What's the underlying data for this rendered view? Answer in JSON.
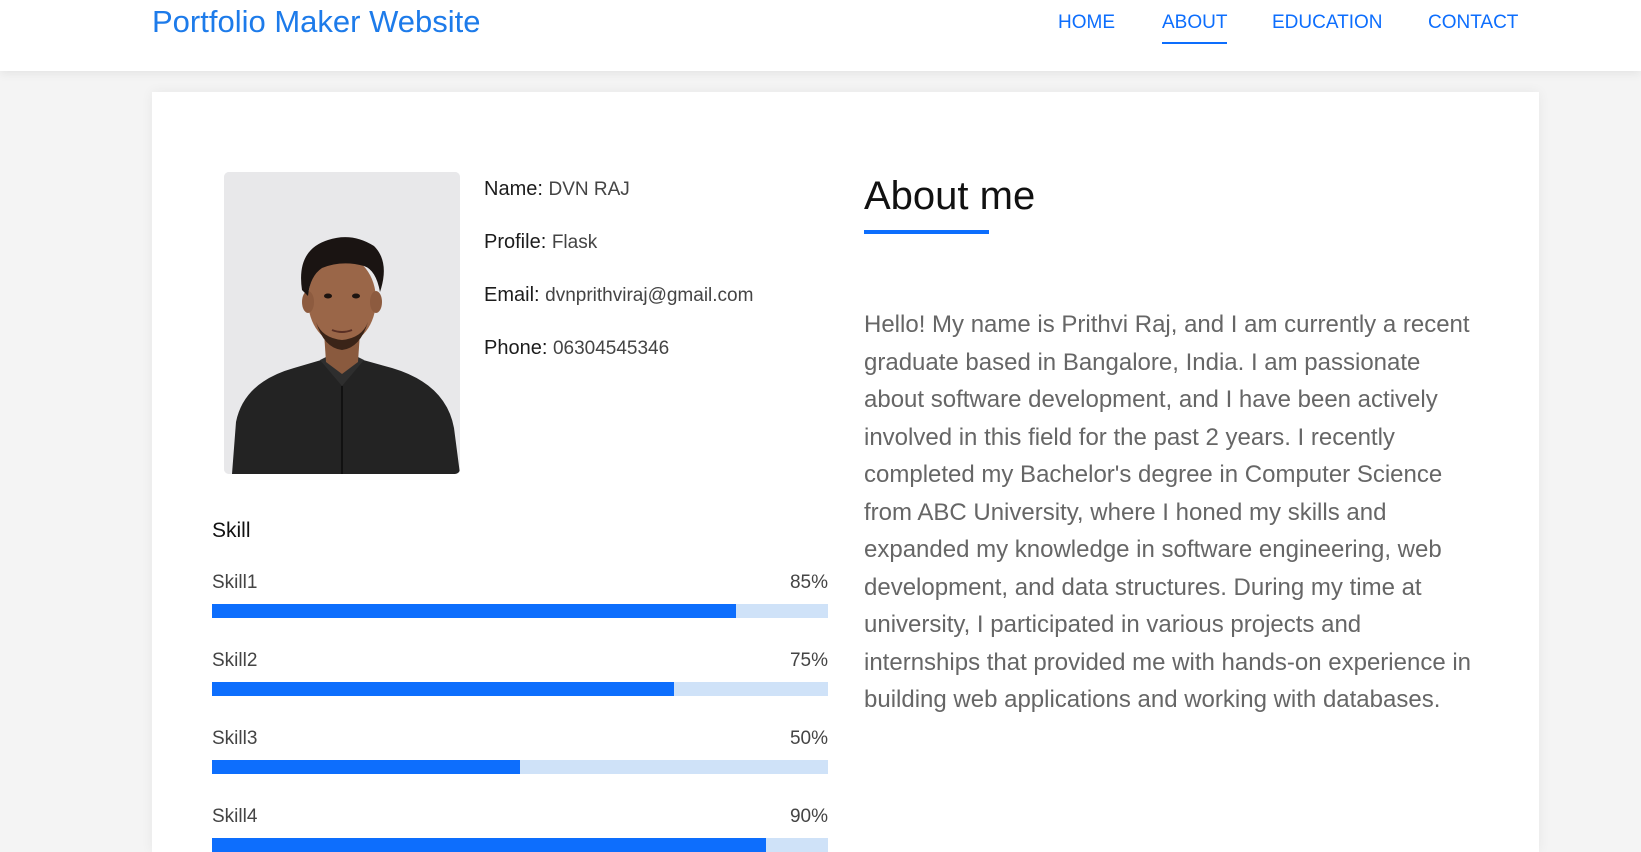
{
  "header": {
    "brand": "Portfolio Maker Website",
    "nav": [
      {
        "label": "HOME"
      },
      {
        "label": "ABOUT"
      },
      {
        "label": "EDUCATION"
      },
      {
        "label": "CONTACT"
      }
    ],
    "active_nav": "ABOUT"
  },
  "profile": {
    "name_label": "Name:",
    "name_value": "DVN RAJ",
    "profile_label": "Profile:",
    "profile_value": "Flask",
    "email_label": "Email:",
    "email_value": "dvnprithviraj@gmail.com",
    "phone_label": "Phone:",
    "phone_value": "06304545346"
  },
  "skills": {
    "title": "Skill",
    "items": [
      {
        "name": "Skill1",
        "percent_label": "85%",
        "level": 0.85
      },
      {
        "name": "Skill2",
        "percent_label": "75%",
        "level": 0.75
      },
      {
        "name": "Skill3",
        "percent_label": "50%",
        "level": 0.5
      },
      {
        "name": "Skill4",
        "percent_label": "90%",
        "level": 0.9
      }
    ]
  },
  "about": {
    "title": "About me",
    "text": "Hello! My name is Prithvi Raj, and I am currently a recent graduate based in Bangalore, India. I am passionate about software development, and I have been actively involved in this field for the past 2 years. I recently completed my Bachelor's degree in Computer Science from ABC University, where I honed my skills and expanded my knowledge in software engineering, web development, and data structures. During my time at university, I participated in various projects and internships that provided me with hands-on experience in building web applications and working with databases."
  },
  "colors": {
    "accent": "#0d6efd",
    "bar_track": "#cfe2f8",
    "brand": "#1d7bea"
  }
}
